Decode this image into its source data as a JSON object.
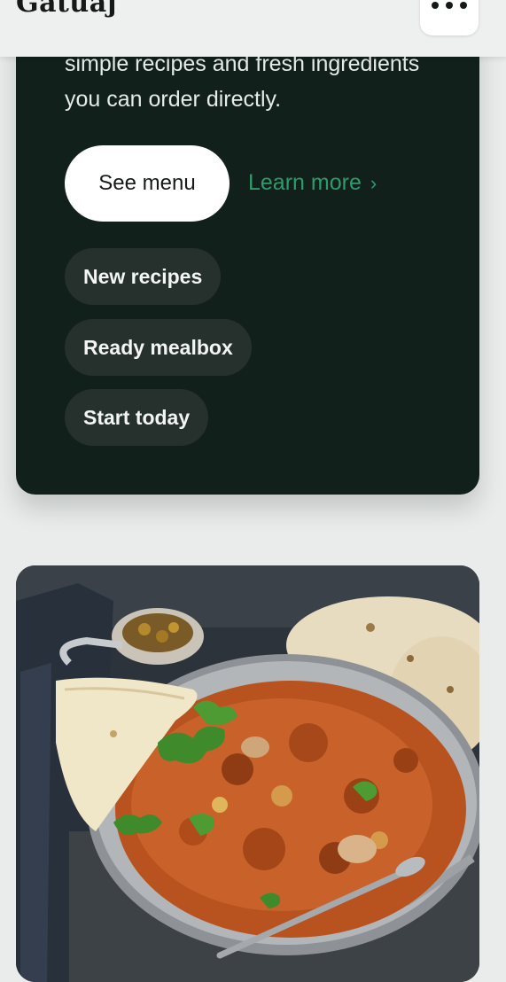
{
  "header": {
    "logo": "Gatuaj",
    "menu_icon": "more-dots-icon"
  },
  "hero": {
    "intro": "simple recipes and fresh ingredients you can order directly.",
    "see_menu_label": "See menu",
    "learn_more_label": "Learn more",
    "learn_more_chevron": "›",
    "tags": [
      "New recipes",
      "Ready mealbox",
      "Start today"
    ]
  },
  "colors": {
    "hero_bg": "#12201c",
    "accent_green": "#2f9a6a",
    "tag_bg": "#26312d",
    "page_bg": "#e9ecea"
  }
}
